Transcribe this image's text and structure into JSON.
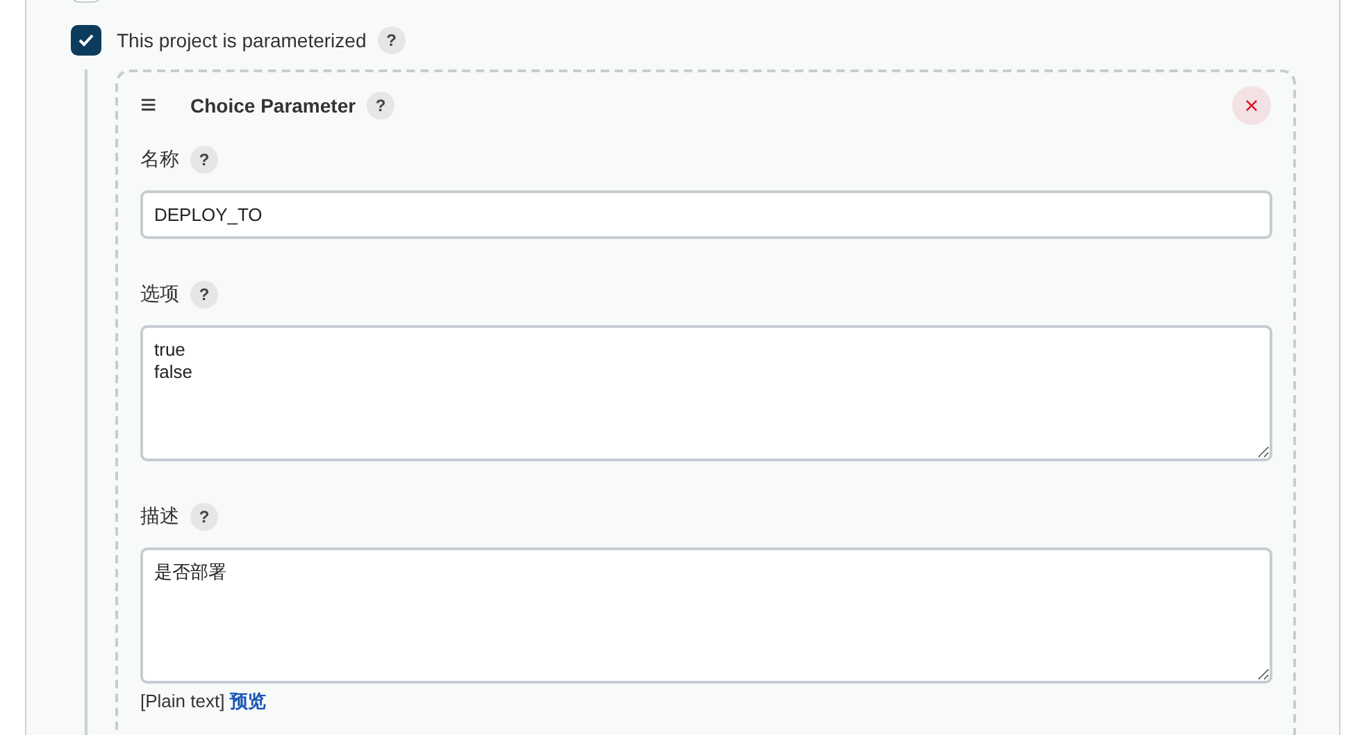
{
  "previous_option": {
    "checked": false
  },
  "parameterized": {
    "label": "This project is parameterized",
    "checked": true,
    "help": "?"
  },
  "parameter": {
    "handle": "≡",
    "title": "Choice Parameter",
    "help": "?",
    "close": "×",
    "fields": [
      {
        "kind": "input",
        "label": "名称",
        "help": "?",
        "value": "DEPLOY_TO"
      },
      {
        "kind": "textarea",
        "label": "选项",
        "help": "?",
        "value": "true\nfalse"
      },
      {
        "kind": "textarea",
        "label": "描述",
        "help": "?",
        "value": "是否部署",
        "format": "[Plain text]",
        "preview": "预览"
      }
    ]
  }
}
